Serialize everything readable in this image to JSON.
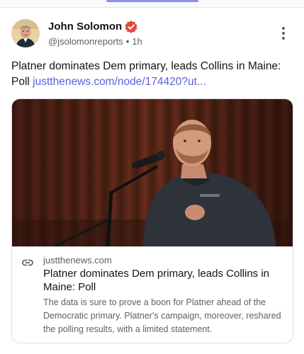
{
  "post": {
    "author_name": "John Solomon",
    "handle": "@jsolomonreports",
    "separator": "•",
    "time": "1h",
    "text": "Platner dominates Dem primary, leads Collins in Maine: Poll ",
    "link_text": "justthenews.com/node/174420?ut...",
    "accent_color": "#5b5ee0",
    "verified_color": "#e2483d"
  },
  "card": {
    "domain": "justthenews.com",
    "title": "Platner dominates Dem primary, leads Collins in Maine: Poll",
    "description": "The data is sure to prove a boon for Platner ahead of the Democratic primary. Platner's campaign, moreover, reshared the polling results, with a limited statement."
  },
  "icons": {
    "verified": "verified-badge-icon",
    "more": "more-vertical-icon",
    "link": "link-icon"
  }
}
